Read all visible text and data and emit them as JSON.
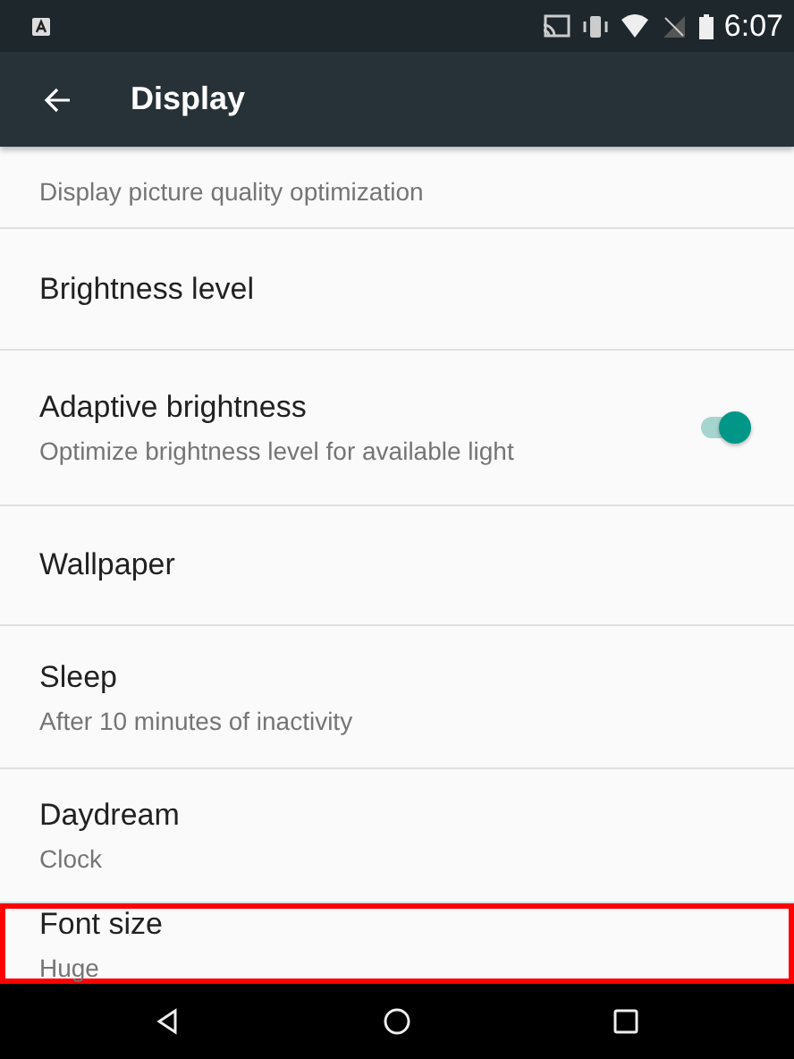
{
  "status_bar": {
    "time": "6:07"
  },
  "toolbar": {
    "title": "Display"
  },
  "settings": [
    {
      "kind": "plain",
      "summary": "Display picture quality optimization",
      "highlighted": false
    },
    {
      "kind": "plain",
      "title": "Brightness level",
      "highlighted": false
    },
    {
      "kind": "switch",
      "title": "Adaptive brightness",
      "summary": "Optimize brightness level for available light",
      "on": true,
      "highlighted": false
    },
    {
      "kind": "plain",
      "title": "Wallpaper",
      "highlighted": false
    },
    {
      "kind": "plain",
      "title": "Sleep",
      "summary": "After 10 minutes of inactivity",
      "highlighted": false
    },
    {
      "kind": "plain",
      "title": "Daydream",
      "summary": "Clock",
      "highlighted": false
    },
    {
      "kind": "plain",
      "title": "Font size",
      "summary": "Huge",
      "highlighted": true
    }
  ]
}
